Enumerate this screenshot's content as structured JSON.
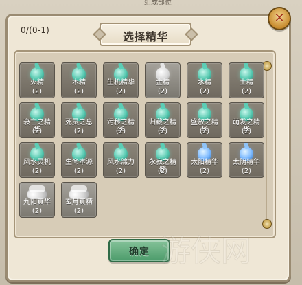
{
  "background": {
    "header_text": "组成部位"
  },
  "dialog": {
    "title": "选择精华",
    "selection_count": "0/(0-1)",
    "confirm_label": "确定",
    "close_symbol": "✕"
  },
  "items": [
    {
      "label": "火精",
      "qty": "(2)",
      "icon": "green-droplet-icon",
      "tile": "dark"
    },
    {
      "label": "木精",
      "qty": "(2)",
      "icon": "green-droplet-icon",
      "tile": "dark"
    },
    {
      "label": "生机精华",
      "qty": "(2)",
      "icon": "green-droplet-icon",
      "tile": "dark"
    },
    {
      "label": "金精",
      "qty": "(2)",
      "icon": "white-droplet-icon",
      "tile": "gray"
    },
    {
      "label": "水精",
      "qty": "(2)",
      "icon": "green-droplet-icon",
      "tile": "dark"
    },
    {
      "label": "土精",
      "qty": "(2)",
      "icon": "green-droplet-icon",
      "tile": "dark"
    },
    {
      "label": "衰亡之精\n华",
      "qty": "(2)",
      "icon": "green-droplet-icon",
      "tile": "dark"
    },
    {
      "label": "死灵之息",
      "qty": "(2)",
      "icon": "green-droplet-icon",
      "tile": "dark"
    },
    {
      "label": "污秽之精\n华",
      "qty": "(2)",
      "icon": "green-droplet-icon",
      "tile": "dark"
    },
    {
      "label": "归藏之精\n华",
      "qty": "(2)",
      "icon": "green-droplet-icon",
      "tile": "dark"
    },
    {
      "label": "盛放之精\n华",
      "qty": "(2)",
      "icon": "green-droplet-icon",
      "tile": "dark"
    },
    {
      "label": "萌发之精\n华",
      "qty": "(2)",
      "icon": "green-droplet-icon",
      "tile": "dark"
    },
    {
      "label": "风水灵机",
      "qty": "(2)",
      "icon": "green-droplet-icon",
      "tile": "dark"
    },
    {
      "label": "生命本源",
      "qty": "(2)",
      "icon": "green-droplet-icon",
      "tile": "dark"
    },
    {
      "label": "风水煞力",
      "qty": "(2)",
      "icon": "green-droplet-icon",
      "tile": "dark"
    },
    {
      "label": "永寂之精\n髓",
      "qty": "(2)",
      "icon": "green-droplet-icon",
      "tile": "dark"
    },
    {
      "label": "太阳精华",
      "qty": "(2)",
      "icon": "blue-droplet-icon",
      "tile": "dark"
    },
    {
      "label": "太阴精华",
      "qty": "(2)",
      "icon": "blue-droplet-icon",
      "tile": "dark"
    },
    {
      "label": "九阳真华",
      "qty": "(2)",
      "icon": "cloud-icon",
      "tile": "gray"
    },
    {
      "label": "玄月真精",
      "qty": "(2)",
      "icon": "cloud-icon",
      "tile": "gray"
    }
  ],
  "watermark": {
    "text": "游侠网"
  }
}
